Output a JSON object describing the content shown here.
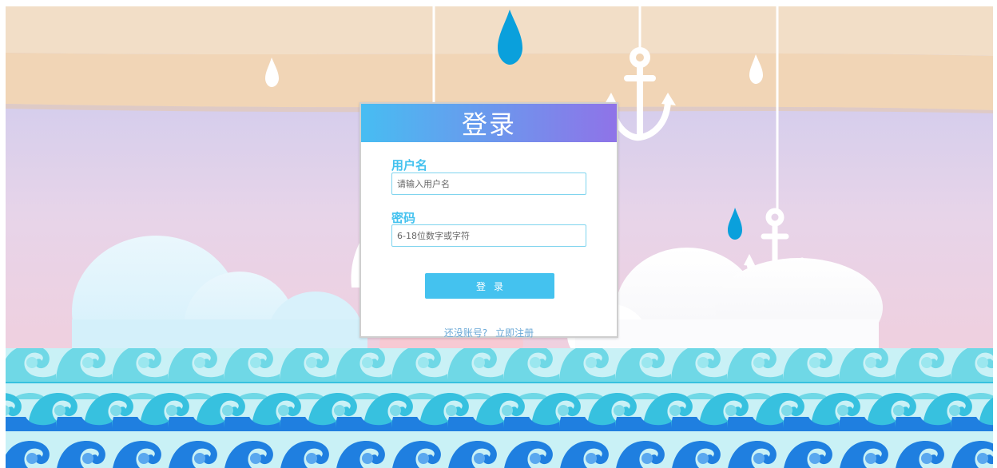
{
  "colors": {
    "accent": "#44c2ef",
    "header_start": "#47bdf2",
    "header_end": "#8f73e8",
    "register_link": "#6aa8d6"
  },
  "login": {
    "title": "登录",
    "username_label": "用户名",
    "username_placeholder": "请输入用户名",
    "password_label": "密码",
    "password_placeholder": "6-18位数字或字符",
    "submit_label": "登录",
    "no_account_text": "还没账号?",
    "register_link": "立即注册"
  },
  "background": {
    "decorations": [
      "raindrop-icon",
      "anchor-icon",
      "cloud",
      "wave"
    ]
  }
}
